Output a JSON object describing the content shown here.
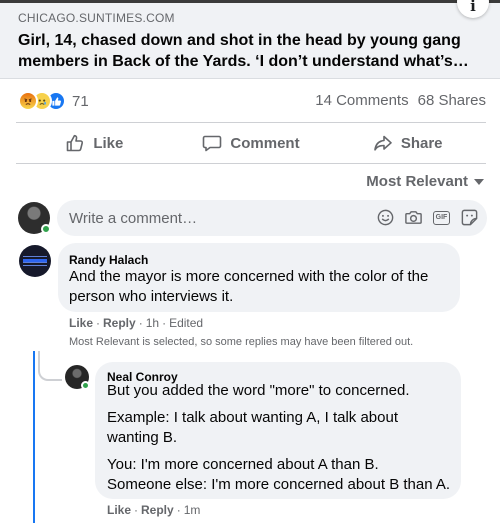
{
  "preview": {
    "domain": "CHICAGO.SUNTIMES.COM",
    "headline": "Girl, 14, chased down and shot in the head by young gang members in Back of the Yards. ‘I don’t understand what’s…",
    "info_icon": "i"
  },
  "reactions": {
    "icons": [
      "angry-icon",
      "sad-icon",
      "like-icon"
    ],
    "count": "71",
    "comments": "14 Comments",
    "shares": "68 Shares"
  },
  "actions": {
    "like": "Like",
    "comment": "Comment",
    "share": "Share"
  },
  "sort": {
    "selected": "Most Relevant"
  },
  "composer": {
    "placeholder": "Write a comment…",
    "tools": [
      "emoji-icon",
      "camera-icon",
      "gif-icon",
      "sticker-icon"
    ],
    "gif_label": "GIF"
  },
  "comments": [
    {
      "author": "Randy Halach",
      "text_line1": "And the mayor is more concerned with the color of the",
      "text_line2": "person who interviews it.",
      "like": "Like",
      "reply": "Reply",
      "time": "1h",
      "edited": "Edited",
      "filter_note": "Most Relevant is selected, so some replies may have been filtered out.",
      "replies": [
        {
          "author": "Neal Conroy",
          "p1": "But you added the word \"more\" to concerned.",
          "p2_line1": "Example: I talk about wanting A, I talk about",
          "p2_line2": "wanting B.",
          "p3_line1": "You: I'm more concerned about A than B.",
          "p3_line2": "Someone else: I'm more concerned about B than A.",
          "like": "Like",
          "reply": "Reply",
          "time": "1m"
        }
      ]
    }
  ],
  "colors": {
    "accent": "#1877f2",
    "muted_text": "#65676b",
    "bubble": "#f0f2f5",
    "online": "#31a24c"
  }
}
